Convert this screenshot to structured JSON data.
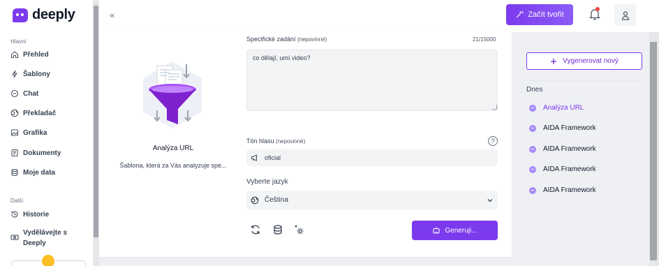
{
  "app": {
    "name": "deeply"
  },
  "sidebar": {
    "section_main": "Hlavní",
    "items": [
      {
        "label": "Přehled",
        "icon": "home-icon"
      },
      {
        "label": "Šablony",
        "icon": "lightning-icon"
      },
      {
        "label": "Chat",
        "icon": "chat-icon"
      },
      {
        "label": "Překladač",
        "icon": "globe-icon"
      },
      {
        "label": "Grafika",
        "icon": "image-icon"
      },
      {
        "label": "Dokumenty",
        "icon": "document-icon"
      },
      {
        "label": "Moje data",
        "icon": "database-icon"
      }
    ],
    "section_other": "Další",
    "other_items": [
      {
        "label": "Historie",
        "icon": "history-icon"
      },
      {
        "label": "Vydělávejte s Deeply",
        "icon": "money-icon"
      }
    ]
  },
  "topbar": {
    "collapse_glyph": "«",
    "cta_label": "Začít tvořit"
  },
  "template": {
    "name": "Analýza URL",
    "description": "Šablona, která za Vás analyzuje spe..."
  },
  "form": {
    "task_label": "Specifické zadání",
    "task_optional": "(nepovinné)",
    "counter": "21/15000",
    "task_value": "co dělají, umí video?",
    "tone_label": "Tón hlasu",
    "tone_optional": "(nepovinné)",
    "help_glyph": "?",
    "tone_value": "oficial",
    "lang_label": "Vyberte jazyk",
    "lang_value": "Čeština",
    "generate_label": "Generuji..."
  },
  "history": {
    "new_label": "Vygenerovat nový",
    "today_label": "Dnes",
    "items": [
      "Analýza URL",
      "AIDA Framework",
      "AIDA Framework",
      "AIDA Framework",
      "AIDA Framework"
    ]
  },
  "colors": {
    "accent": "#7c3aed",
    "accent_light": "#a78bfa",
    "notification": "#ef4444"
  }
}
